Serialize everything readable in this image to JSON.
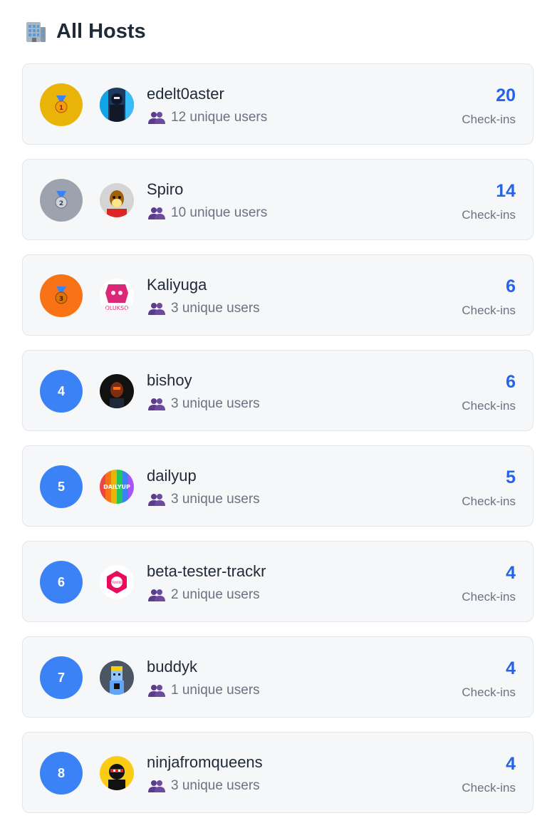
{
  "header": {
    "title": "All Hosts",
    "icon": "office-building-icon"
  },
  "colors": {
    "gold": "#eab308",
    "silver": "#9ca3af",
    "bronze": "#f97316",
    "rank_blue": "#3b82f6",
    "count_blue": "#2563eb"
  },
  "hosts": [
    {
      "rank": "1",
      "medal": "gold",
      "name": "edelt0aster",
      "users": "12 unique users",
      "count": "20",
      "count_label": "Check-ins"
    },
    {
      "rank": "2",
      "medal": "silver",
      "name": "Spiro",
      "users": "10 unique users",
      "count": "14",
      "count_label": "Check-ins"
    },
    {
      "rank": "3",
      "medal": "bronze",
      "name": "Kaliyuga",
      "users": "3 unique users",
      "count": "6",
      "count_label": "Check-ins",
      "avatar_text": "OLUKSO"
    },
    {
      "rank": "4",
      "name": "bishoy",
      "users": "3 unique users",
      "count": "6",
      "count_label": "Check-ins"
    },
    {
      "rank": "5",
      "name": "dailyup",
      "users": "3 unique users",
      "count": "5",
      "count_label": "Check-ins",
      "avatar_text": "DAILYUP"
    },
    {
      "rank": "6",
      "name": "beta-tester-trackr",
      "users": "2 unique users",
      "count": "4",
      "count_label": "Check-ins",
      "avatar_text": "TRACKR"
    },
    {
      "rank": "7",
      "name": "buddyk",
      "users": "1 unique users",
      "count": "4",
      "count_label": "Check-ins"
    },
    {
      "rank": "8",
      "name": "ninjafromqueens",
      "users": "3 unique users",
      "count": "4",
      "count_label": "Check-ins"
    }
  ]
}
